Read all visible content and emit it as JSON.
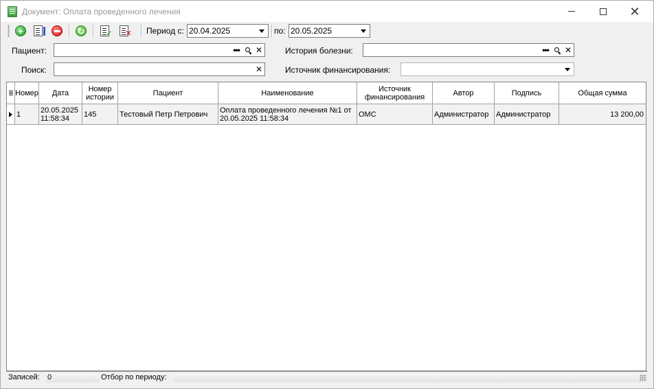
{
  "window": {
    "title": "Документ: Оплата проведенного лечения",
    "icon": "document-app-icon"
  },
  "toolbar": {
    "buttons": [
      {
        "name": "add-button",
        "icon": "plus-circle-icon"
      },
      {
        "name": "edit-button",
        "icon": "document-edit-icon"
      },
      {
        "name": "delete-button",
        "icon": "minus-circle-icon"
      },
      {
        "name": "refresh-button",
        "icon": "refresh-icon"
      },
      {
        "name": "sign-button",
        "icon": "document-check-icon"
      },
      {
        "name": "unsign-button",
        "icon": "document-cross-icon"
      }
    ],
    "period_from_label": "Период с:",
    "period_from_value": "20.04.2025",
    "period_to_label": "по:",
    "period_to_value": "20.05.2025"
  },
  "filters": {
    "patient_label": "Пациент:",
    "patient_value": "",
    "history_label": "История болезни:",
    "history_value": "",
    "search_label": "Поиск:",
    "search_value": "",
    "funding_label": "Источник финансирования:",
    "funding_value": ""
  },
  "grid": {
    "columns": [
      "Номер",
      "Дата",
      "Номер истории",
      "Пациент",
      "Наименование",
      "Источник финансирования",
      "Автор",
      "Подпись",
      "Общая сумма"
    ],
    "rows": [
      {
        "number": "1",
        "date": "20.05.2025 11:58:34",
        "history": "145",
        "patient": "Тестовый Петр Петрович",
        "name": "Оплата проведенного лечения №1 от 20.05.2025 11:58:34",
        "funding": "ОМС",
        "author": "Администратор",
        "signature": "Администратор",
        "total": "13 200,00"
      }
    ]
  },
  "status": {
    "records_label": "Записей:",
    "records_value": "0",
    "period_filter_label": "Отбор по периоду:",
    "period_filter_value": ""
  },
  "colors": {
    "window_bg": "#f0f0f0",
    "grid_bg": "#ffffff",
    "row_bg": "#f2f2f2",
    "title_text": "#999999"
  }
}
